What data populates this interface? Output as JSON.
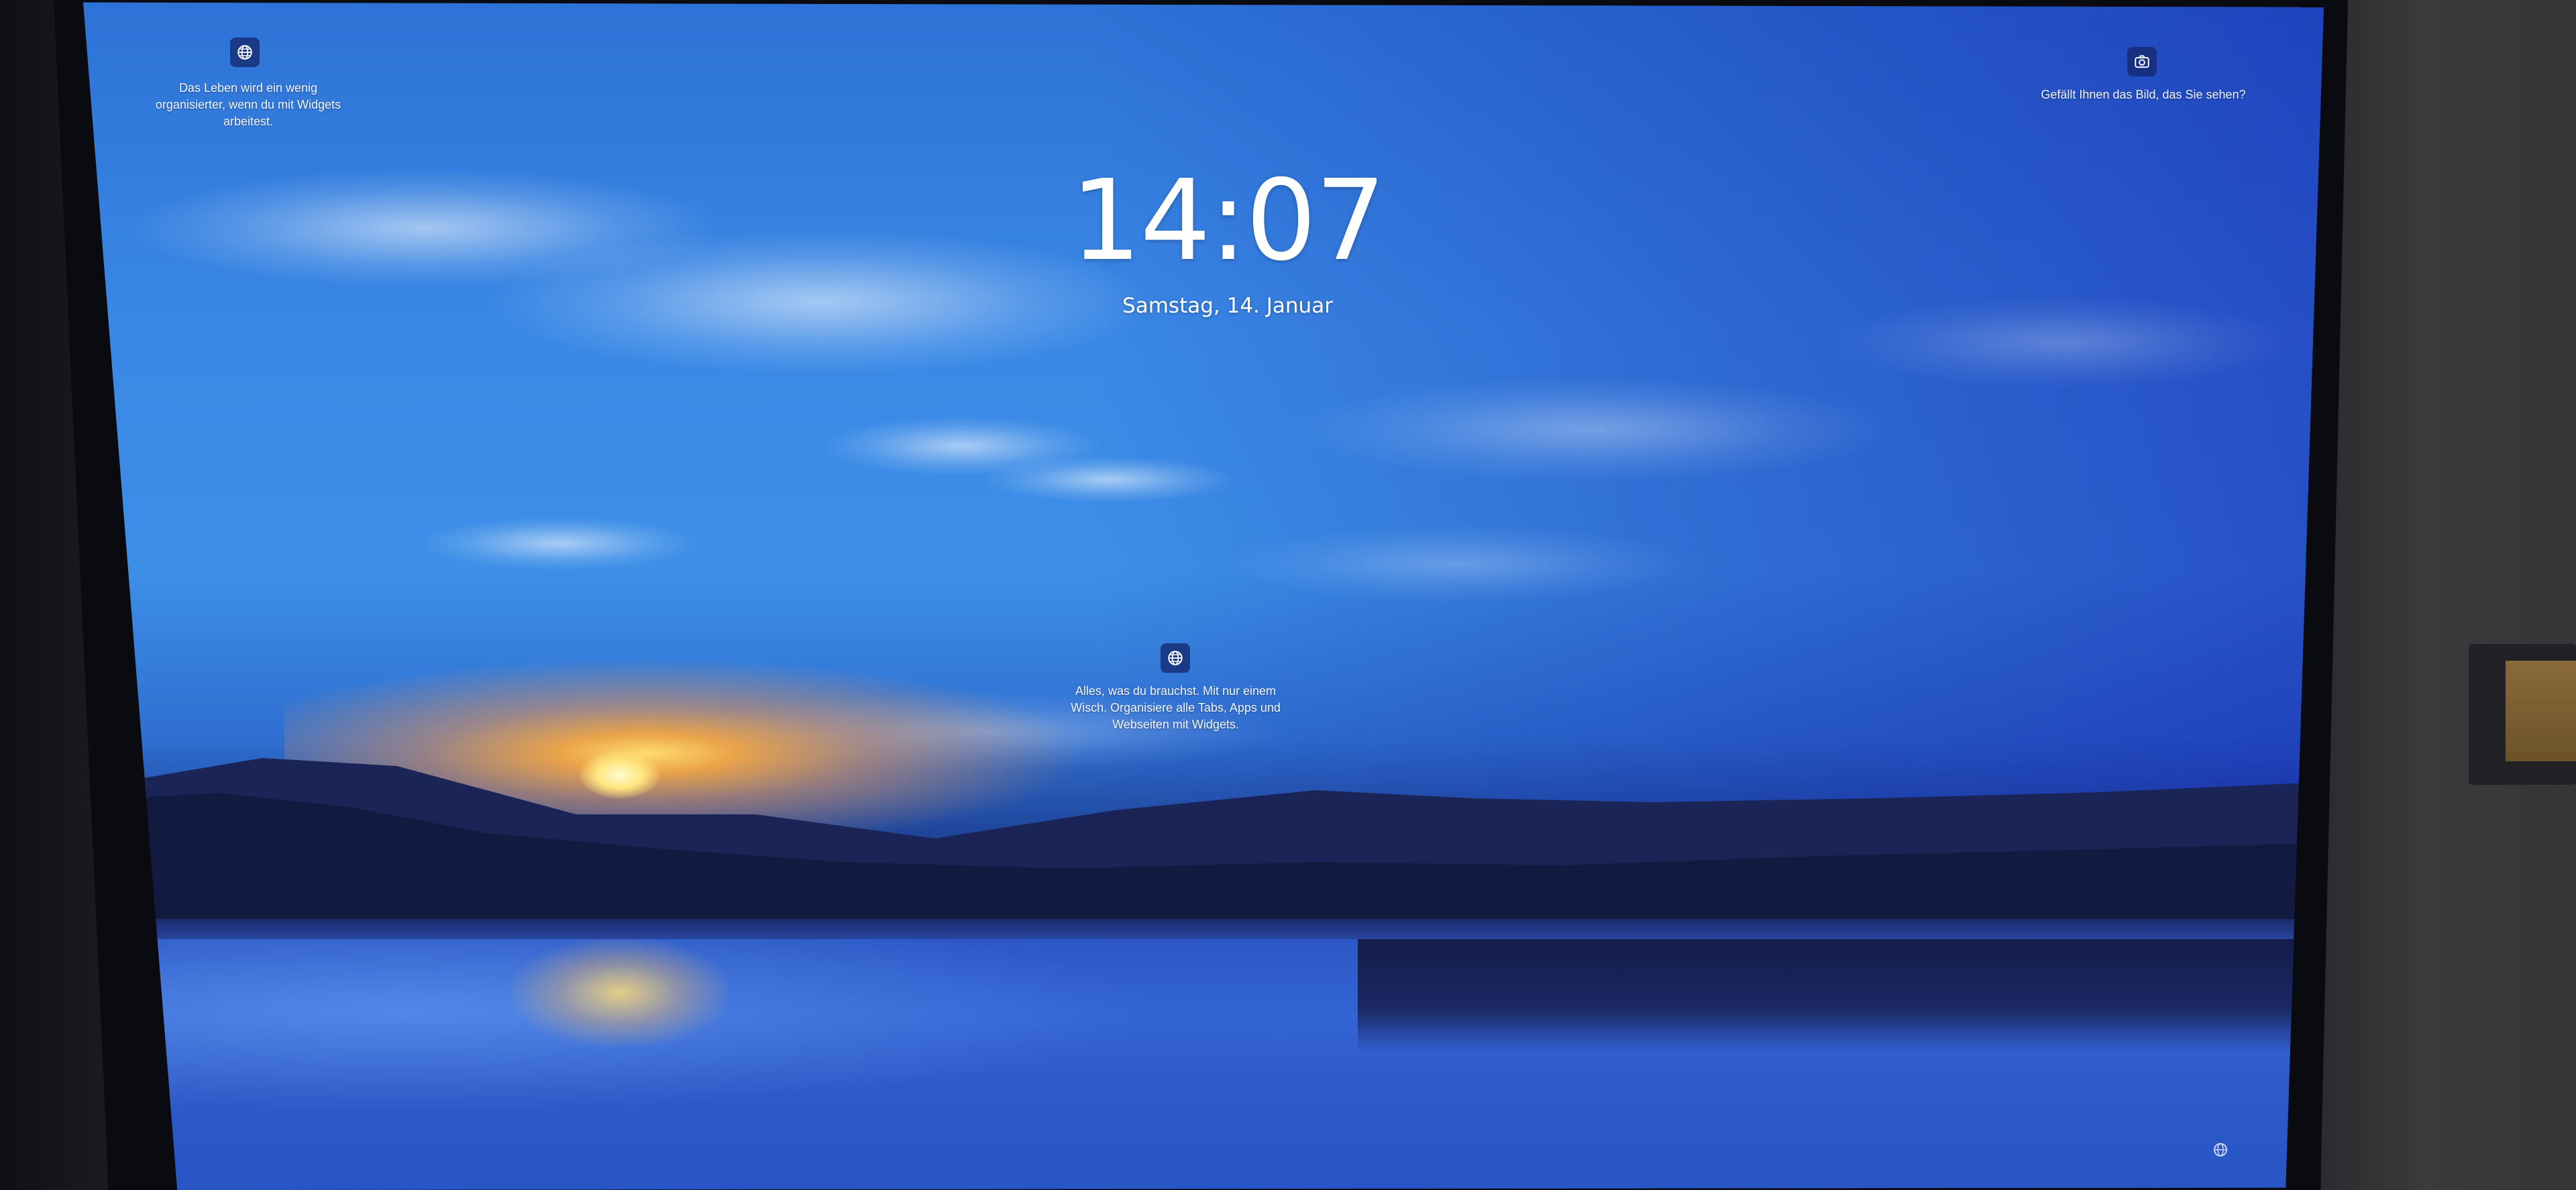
{
  "lock_screen": {
    "time": "14:07",
    "date": "Samstag, 14. Januar"
  },
  "widgets": {
    "top_left": {
      "icon": "globe-icon",
      "text_lines": [
        "Das Leben wird ein wenig",
        "organisierter, wenn du mit Widgets",
        "arbeitest."
      ]
    },
    "center": {
      "icon": "globe-icon",
      "text_lines": [
        "Alles, was du brauchst. Mit nur einem",
        "Wisch. Organisiere alle Tabs, Apps und",
        "Webseiten mit Widgets."
      ]
    },
    "top_right": {
      "icon": "camera-icon",
      "text_lines": [
        "Gefällt Ihnen das Bild, das Sie sehen?"
      ]
    }
  },
  "status": {
    "network_icon": "network-icon"
  },
  "colors": {
    "accent_icon_bg": "#142c6e",
    "text": "#ffffff"
  }
}
